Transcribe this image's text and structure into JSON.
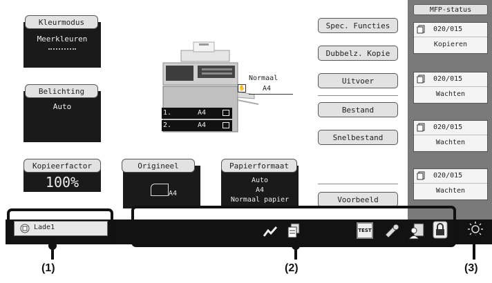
{
  "left_panel": {
    "color_mode": {
      "label": "Kleurmodus",
      "value": "Meerkleuren"
    },
    "exposure": {
      "label": "Belichting",
      "value": "Auto"
    },
    "ratio": {
      "label": "Kopieerfactor",
      "value": "100%"
    }
  },
  "center": {
    "output_tray": {
      "mode": "Normaal",
      "size": "A4"
    },
    "trays": [
      {
        "number": "1.",
        "size": "A4"
      },
      {
        "number": "2.",
        "size": "A4"
      }
    ],
    "original": {
      "label": "Origineel",
      "size": "A4"
    },
    "paper_size": {
      "label": "Papierformaat",
      "mode": "Auto",
      "size": "A4",
      "type": "Normaal papier"
    }
  },
  "right_buttons": {
    "special_functions": "Spec. Functies",
    "duplex_copy": "Dubbelz. Kopie",
    "output": "Uitvoer",
    "file": "Bestand",
    "quick_file": "Snelbestand",
    "preview": "Voorbeeld"
  },
  "mfp_status": {
    "title": "MFP-status",
    "jobs": [
      {
        "count": "020/015",
        "status": "Kopieren"
      },
      {
        "count": "020/015",
        "status": "Wachten"
      },
      {
        "count": "020/015",
        "status": "Wachten"
      },
      {
        "count": "020/015",
        "status": "Wachten"
      }
    ]
  },
  "bottom_bar": {
    "tray_label": "Lade1",
    "icons": [
      "line-graph-icon",
      "document-stack-icon",
      "test-mode-icon",
      "tools-icon",
      "user-auth-icon",
      "lock-icon"
    ],
    "brightness_icon": "sun-icon"
  },
  "callouts": {
    "c1": "(1)",
    "c2": "(2)",
    "c3": "(3)"
  },
  "colors": {
    "panel_dark": "#1a1a1a",
    "button_grey": "#e2e2e2",
    "status_column": "#7a7a7a",
    "bar": "#121212"
  }
}
